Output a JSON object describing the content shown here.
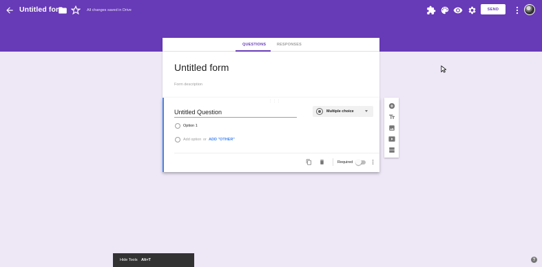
{
  "header": {
    "title": "Untitled form",
    "saved_status": "All changes saved in Drive",
    "send_label": "SEND",
    "theme_color": "#673ab7",
    "icons": [
      "back-arrow-icon",
      "folder-icon",
      "star-icon",
      "addon-puzzle-icon",
      "palette-icon",
      "preview-eye-icon",
      "settings-gear-icon",
      "more-vert-icon",
      "avatar"
    ]
  },
  "tabs": [
    {
      "label": "QUESTIONS",
      "active": true
    },
    {
      "label": "RESPONSES",
      "active": false
    }
  ],
  "form": {
    "title": "Untitled form",
    "description_placeholder": "Form description"
  },
  "question": {
    "title": "Untitled Question",
    "type": "Multiple choice",
    "options": [
      "Option 1"
    ],
    "add_option_label": "Add option",
    "or_label": "or",
    "add_other_label": "ADD \"OTHER\"",
    "required_label": "Required",
    "required": false
  },
  "side_tools": [
    "add-question-icon",
    "add-title-icon",
    "add-image-icon",
    "add-video-icon",
    "add-section-icon"
  ],
  "toast": {
    "label": "Hide Tools",
    "shortcut": "Alt+T"
  },
  "help_label": "?"
}
